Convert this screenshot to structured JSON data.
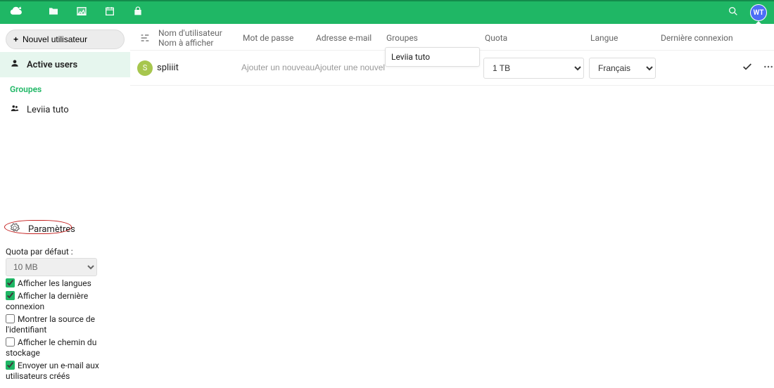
{
  "topbar": {
    "avatar_initials": "WT"
  },
  "sidebar": {
    "new_user_label": "Nouvel utilisateur",
    "active_users_label": "Active users",
    "groups_title": "Groupes",
    "group_items": [
      "Leviia tuto"
    ]
  },
  "settings": {
    "toggle_label": "Paramètres",
    "quota_label": "Quota par défaut :",
    "quota_value": "10 MB",
    "opt_show_languages": "Afficher les langues",
    "opt_show_last_login": "Afficher la dernière connexion",
    "opt_show_backend": "Montrer la source de l'identifiant",
    "opt_show_storage_path": "Afficher le chemin du stockage",
    "opt_send_email": "Envoyer un e-mail aux utilisateurs créés",
    "checked": {
      "langs": true,
      "last_login": true,
      "backend": false,
      "storage": false,
      "email": true
    }
  },
  "table": {
    "headers": {
      "username_line1": "Nom d'utilisateur",
      "username_line2": "Nom à afficher",
      "password": "Mot de passe",
      "email": "Adresse e-mail",
      "groups": "Groupes",
      "quota": "Quota",
      "language": "Langue",
      "last_login": "Dernière connexion"
    },
    "rows": [
      {
        "avatar_letter": "S",
        "username": "spliiit",
        "password_placeholder": "Ajouter un nouveau mot",
        "email_placeholder": "Ajouter une nouvelle …",
        "groups_popup_value": "Leviia tuto",
        "quota": "1 TB",
        "language": "Français",
        "last_login": ""
      }
    ]
  }
}
